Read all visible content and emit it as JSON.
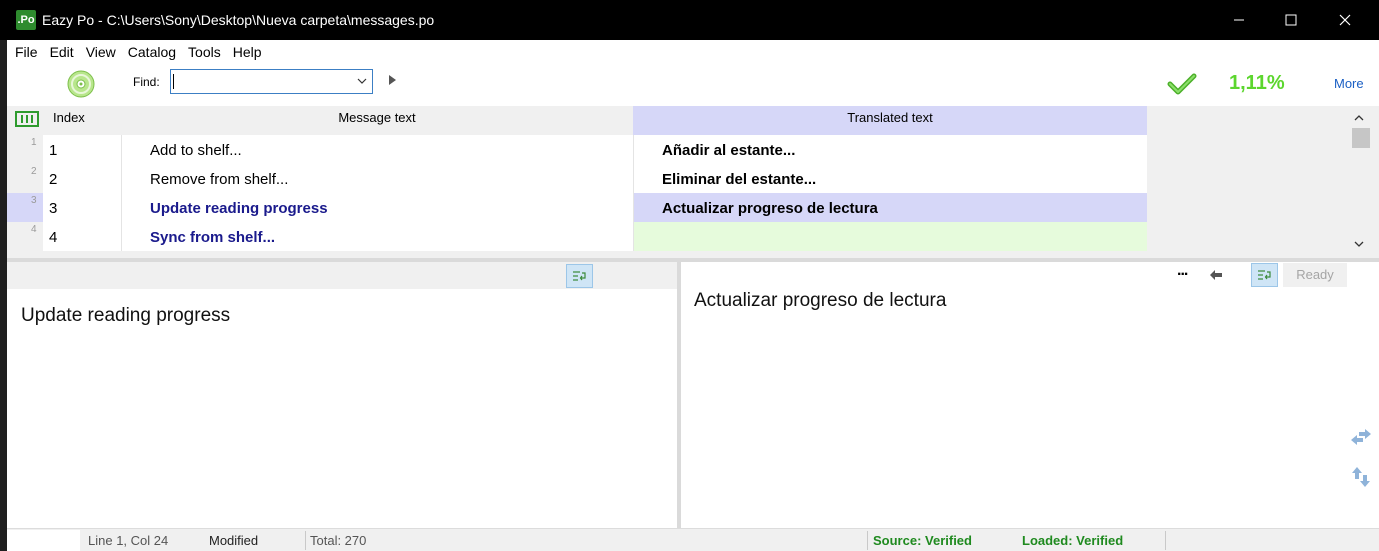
{
  "window": {
    "app_icon_text": ".Po",
    "title": "Eazy Po - C:\\Users\\Sony\\Desktop\\Nueva carpeta\\messages.po"
  },
  "menu": [
    "File",
    "Edit",
    "View",
    "Catalog",
    "Tools",
    "Help"
  ],
  "toolbar": {
    "find_label": "Find:",
    "find_value": "",
    "progress": "1,11%",
    "more": "More",
    "accent": "#5cd62e"
  },
  "grid": {
    "headers": {
      "index": "Index",
      "message": "Message text",
      "translated": "Translated text"
    },
    "rows": [
      {
        "rownum": "1",
        "index": "1",
        "message": "Add to shelf...",
        "translation": "Añadir al estante..."
      },
      {
        "rownum": "2",
        "index": "2",
        "message": "Remove from shelf...",
        "translation": "Eliminar del estante..."
      },
      {
        "rownum": "3",
        "index": "3",
        "message": "Update reading progress",
        "translation": "Actualizar progreso de lectura"
      },
      {
        "rownum": "4",
        "index": "4",
        "message": "Sync from shelf...",
        "translation": ""
      }
    ]
  },
  "source_pane": {
    "text": "Update reading progress"
  },
  "translation_pane": {
    "text": "Actualizar progreso de lectura",
    "more_dots": "...",
    "ready": "Ready"
  },
  "statusbar": {
    "position": "Line 1, Col 24",
    "state": "Modified",
    "total": "Total: 270",
    "source": "Source: Verified",
    "loaded": "Loaded: Verified"
  }
}
